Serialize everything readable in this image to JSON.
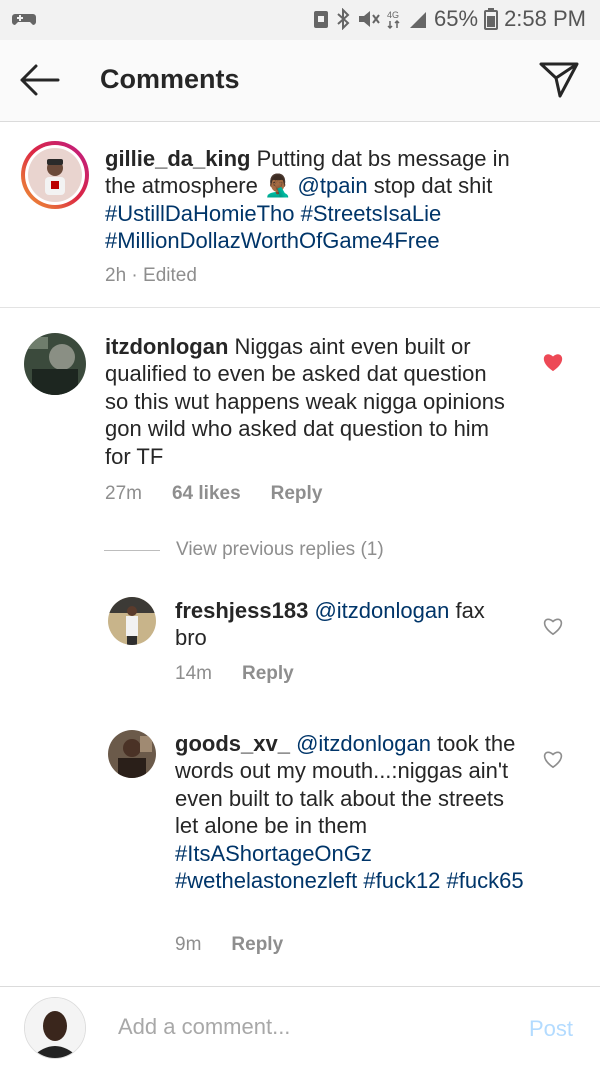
{
  "status_bar": {
    "battery": "65%",
    "time": "2:58 PM",
    "icons": [
      "gamepad-icon",
      "alarm-icon",
      "bluetooth-icon",
      "mute-icon",
      "lte-icon",
      "signal-icon",
      "battery-icon"
    ]
  },
  "header": {
    "title": "Comments",
    "icons": [
      "back-arrow-icon",
      "send-icon"
    ]
  },
  "caption": {
    "username": "gillie_da_king",
    "text_1": "Putting dat bs message in the atmosphere",
    "emoji": "🤦🏾‍♂️",
    "mention": "@tpain",
    "text_2": "stop dat shit",
    "tags": [
      "#UstillDaHomieTho",
      "#StreetsIsaLie",
      "#MillionDollazWorthOfGame4Free"
    ],
    "meta": "2h · Edited"
  },
  "comments": [
    {
      "username": "itzdonlogan",
      "text": "Niggas aint even built or qualified to even be asked dat question so this wut happens weak nigga opinions gon wild who asked dat question to him for TF",
      "time": "27m",
      "likes": "64 likes",
      "reply": "Reply",
      "liked": true
    }
  ],
  "view_previous": "View previous replies (1)",
  "replies": [
    {
      "username": "freshjess183",
      "mention": "@itzdonlogan",
      "text": "fax bro",
      "time": "14m",
      "reply": "Reply",
      "liked": false
    },
    {
      "username": "goods_xv_",
      "mention": "@itzdonlogan",
      "text": "took the words out my mouth...:niggas ain't even built to talk about the streets let alone be in them",
      "tags": [
        "#ItsAShortageOnGz",
        "#wethelastonezleft",
        "#fuck12",
        "#fuck65"
      ],
      "time": "9m",
      "reply": "Reply",
      "liked": false
    }
  ],
  "composer": {
    "placeholder": "Add a comment...",
    "post": "Post"
  },
  "colors": {
    "link": "#003569",
    "meta": "#8e8e8e",
    "heart_liked": "#ed4956",
    "post_disabled": "#b3dbff"
  }
}
